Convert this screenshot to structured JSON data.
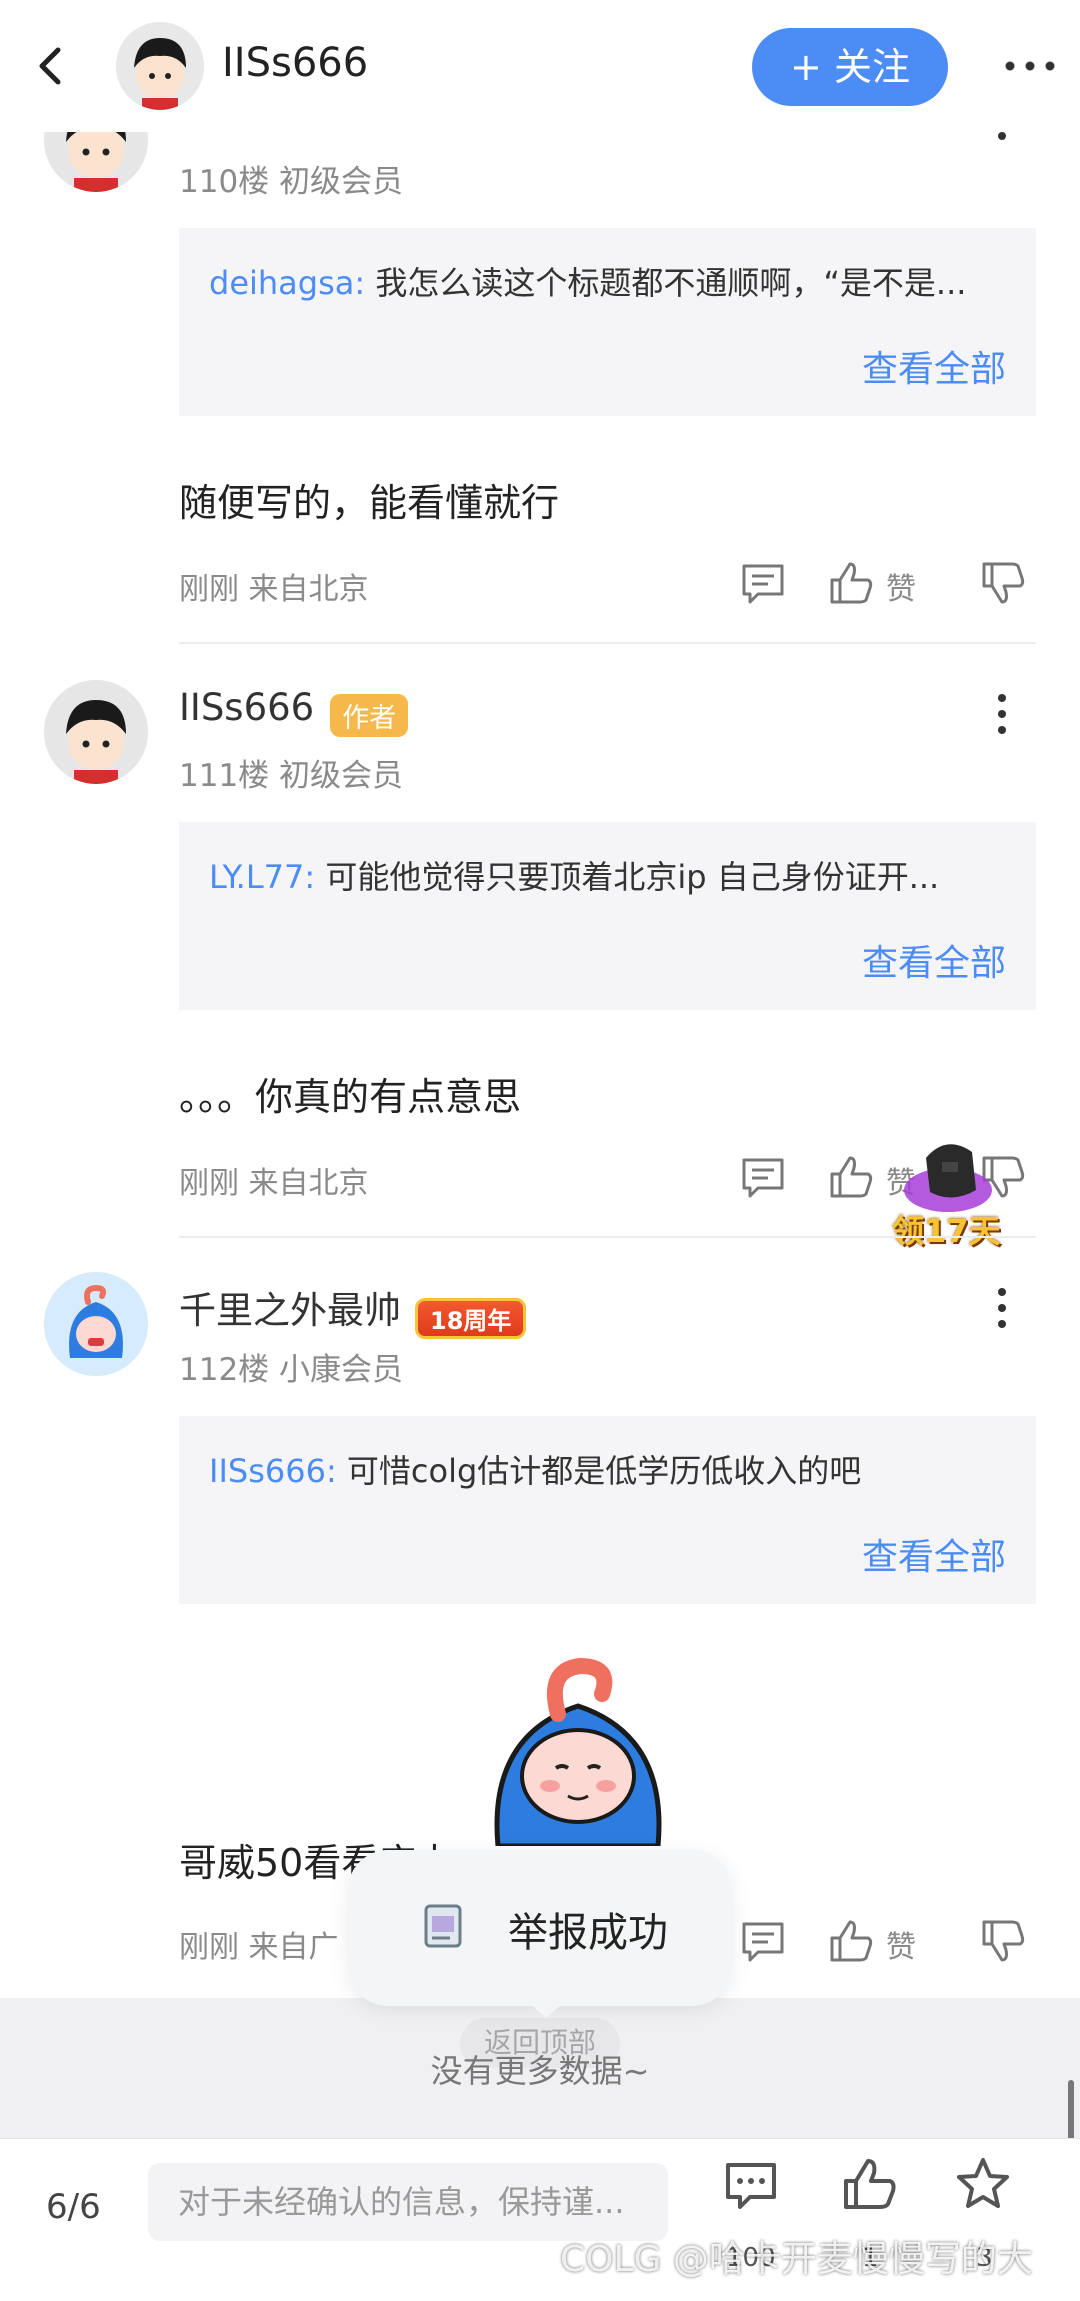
{
  "header": {
    "title": "IISs666",
    "follow_label": "+ 关注"
  },
  "top_post": {
    "floor_meta": "110楼  初级会员",
    "quote_user": "deihagsa:",
    "quote_text": "我怎么读这个标题都不通顺啊，“是不是...",
    "view_all": "查看全部",
    "content": "随便写的，能看懂就行",
    "meta": "刚刚 来自北京",
    "like_label": "赞"
  },
  "posts": [
    {
      "username": "IISs666",
      "badge": "作者",
      "floor_meta": "111楼  初级会员",
      "quote_user": "LY.L77:",
      "quote_text": "可能他觉得只要顶着北京ip  自己身份证开...",
      "view_all": "查看全部",
      "content": "。。。你真的有点意思",
      "meta": "刚刚 来自北京",
      "like_label": "赞"
    },
    {
      "username": "千里之外最帅",
      "badge": "18周年",
      "floor_meta": "112楼  小康会员",
      "quote_user": "IISs666:",
      "quote_text": "可惜colg估计都是低学历低收入的吧",
      "view_all": "查看全部",
      "content": "哥威50看看实力",
      "meta": "刚刚 来自广",
      "like_label": "赞"
    }
  ],
  "promo": {
    "label": "领17天"
  },
  "toast": {
    "text": "举报成功"
  },
  "back_top": "返回顶部",
  "no_more": "没有更多数据~",
  "bottom_bar": {
    "page_indicator": "6/6",
    "input_placeholder": "对于未经确认的信息，保持谨...",
    "comment_count": "100",
    "like_count": "1",
    "fav_count": "3"
  },
  "watermark": "COLG @哈卡开麦慢慢写的大",
  "colors": {
    "accent": "#4c8cf5",
    "author_badge": "#f7b84b",
    "anniv_badge": "#e03a1b"
  },
  "icons": [
    "back-icon",
    "more-icon",
    "kebab-icon",
    "reply-icon",
    "thumbs-up-icon",
    "thumbs-down-icon",
    "comment-icon",
    "star-icon"
  ]
}
